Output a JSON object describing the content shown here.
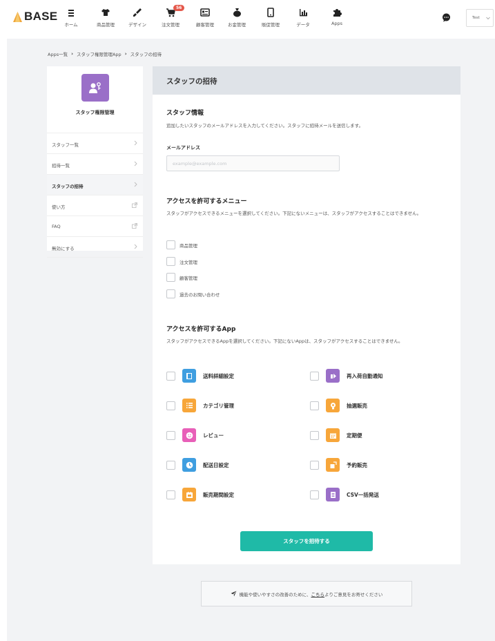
{
  "header": {
    "logo": "BASE",
    "nav": [
      {
        "label": "ホーム",
        "icon": "menu-list-icon"
      },
      {
        "label": "商品管理",
        "icon": "tshirt-icon"
      },
      {
        "label": "デザイン",
        "icon": "brush-icon"
      },
      {
        "label": "注文管理",
        "icon": "cart-icon",
        "badge": "56"
      },
      {
        "label": "顧客管理",
        "icon": "customer-card-icon"
      },
      {
        "label": "お金管理",
        "icon": "money-bag-icon"
      },
      {
        "label": "販促管理",
        "icon": "phone-icon"
      },
      {
        "label": "データ",
        "icon": "bar-chart-icon"
      },
      {
        "label": "Apps",
        "icon": "puzzle-icon"
      }
    ],
    "shop_select_value": "Test"
  },
  "breadcrumb": {
    "items": [
      "Apps一覧",
      "スタッフ権限管理App",
      "スタッフの招待"
    ]
  },
  "sidebar": {
    "app_title": "スタッフ権限管理",
    "items": [
      {
        "label": "スタッフ一覧",
        "icon": "chevron-right-icon",
        "active": false
      },
      {
        "label": "招待一覧",
        "icon": "chevron-right-icon",
        "active": false
      },
      {
        "label": "スタッフの招待",
        "icon": "chevron-right-icon",
        "active": true
      },
      {
        "label": "使い方",
        "icon": "external-link-icon",
        "active": false
      },
      {
        "label": "FAQ",
        "icon": "external-link-icon",
        "active": false
      },
      {
        "label": "無効にする",
        "icon": "chevron-right-icon",
        "active": false
      }
    ]
  },
  "main": {
    "title": "スタッフの招待",
    "staff_info": {
      "title": "スタッフ情報",
      "desc": "追加したいスタッフのメールアドレスを入力してください。スタッフに招待メールを送信します。",
      "email_label": "メールアドレス",
      "email_placeholder": "example@example.com",
      "email_value": ""
    },
    "menu_access": {
      "title": "アクセスを許可するメニュー",
      "desc": "スタッフがアクセスできるメニューを選択してください。下記にないメニューは、スタッフがアクセスすることはできません。",
      "items": [
        "商品管理",
        "注文管理",
        "顧客管理",
        "過去のお問い合わせ"
      ]
    },
    "app_access": {
      "title": "アクセスを許可するApp",
      "desc": "スタッフがアクセスできるAppを選択してください。下記にないAppは、スタッフがアクセスすることはできません。",
      "apps": [
        {
          "label": "送料詳細設定",
          "color": "#3f9ee0",
          "icon": "shipping-doc-icon"
        },
        {
          "label": "再入荷自動通知",
          "color": "#9a6fc8",
          "icon": "restock-bell-icon"
        },
        {
          "label": "カテゴリ管理",
          "color": "#f7a63a",
          "icon": "category-list-icon"
        },
        {
          "label": "抽選販売",
          "color": "#f7a63a",
          "icon": "lottery-icon"
        },
        {
          "label": "レビュー",
          "color": "#e85fb8",
          "icon": "smile-face-icon"
        },
        {
          "label": "定期便",
          "color": "#f7a63a",
          "icon": "calendar-icon"
        },
        {
          "label": "配送日設定",
          "color": "#3f9ee0",
          "icon": "clock-icon"
        },
        {
          "label": "予約販売",
          "color": "#f7a63a",
          "icon": "reserve-icon"
        },
        {
          "label": "販売期間設定",
          "color": "#f7a63a",
          "icon": "sale-period-icon"
        },
        {
          "label": "CSV一括発送",
          "color": "#9a6fc8",
          "icon": "csv-ship-icon"
        }
      ]
    },
    "submit_label": "スタッフを招待する"
  },
  "feedback": {
    "pre": "機能や使いやすさの改善のために、",
    "link": "こちら",
    "post": "よりご意見をお寄せください"
  },
  "colors": {
    "accent": "#1fbaa7",
    "badge": "#e4584b",
    "purple": "#9a6fc8",
    "blue": "#3f9ee0",
    "orange": "#f7a63a",
    "pink": "#e85fb8"
  }
}
